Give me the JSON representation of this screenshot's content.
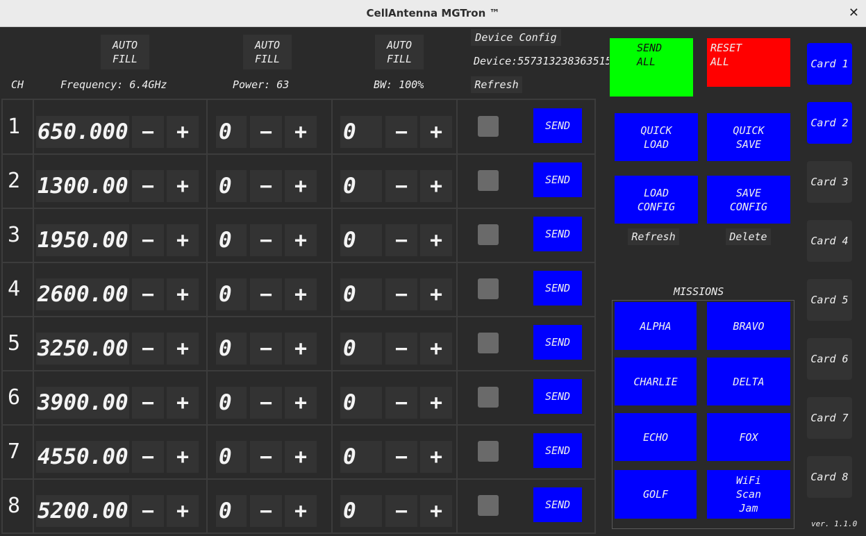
{
  "window": {
    "title": "CellAntenna MGTron ™",
    "close_glyph": "✕"
  },
  "header": {
    "ch_label": "CH",
    "autofill_label": "AUTO\nFILL",
    "frequency_label": "Frequency: 6.4GHz",
    "power_label": "Power: 63",
    "bw_label": "BW: 100%",
    "device_config_label": "Device Config",
    "device_label": "Device:557313238363515",
    "refresh_label": "Refresh"
  },
  "channels": [
    {
      "num": "1",
      "frequency": "650.000",
      "power": "0",
      "bw": "0",
      "send": "SEND"
    },
    {
      "num": "2",
      "frequency": "1300.00",
      "power": "0",
      "bw": "0",
      "send": "SEND"
    },
    {
      "num": "3",
      "frequency": "1950.00",
      "power": "0",
      "bw": "0",
      "send": "SEND"
    },
    {
      "num": "4",
      "frequency": "2600.00",
      "power": "0",
      "bw": "0",
      "send": "SEND"
    },
    {
      "num": "5",
      "frequency": "3250.00",
      "power": "0",
      "bw": "0",
      "send": "SEND"
    },
    {
      "num": "6",
      "frequency": "3900.00",
      "power": "0",
      "bw": "0",
      "send": "SEND"
    },
    {
      "num": "7",
      "frequency": "4550.00",
      "power": "0",
      "bw": "0",
      "send": "SEND"
    },
    {
      "num": "8",
      "frequency": "5200.00",
      "power": "0",
      "bw": "0",
      "send": "SEND"
    }
  ],
  "stepper": {
    "minus": "−",
    "plus": "+"
  },
  "controls": {
    "send_all": "SEND\nALL",
    "reset_all": "RESET\nALL",
    "quick_load": "QUICK\nLOAD",
    "quick_save": "QUICK\nSAVE",
    "load_config": "LOAD\nCONFIG",
    "save_config": "SAVE\nCONFIG",
    "refresh": "Refresh",
    "delete": "Delete",
    "send_all_color": "#00ff00",
    "reset_all_color": "#ff0000",
    "accent_color": "#0000ff"
  },
  "missions": {
    "title": "MISSIONS",
    "items": [
      "ALPHA",
      "BRAVO",
      "CHARLIE",
      "DELTA",
      "ECHO",
      "FOX",
      "GOLF",
      "WiFi\nScan\nJam"
    ]
  },
  "cards": {
    "items": [
      "Card 1",
      "Card 2",
      "Card 3",
      "Card 4",
      "Card 5",
      "Card 6",
      "Card 7",
      "Card 8"
    ],
    "active": [
      true,
      true,
      false,
      false,
      false,
      false,
      false,
      false
    ]
  },
  "version": "ver. 1.1.0"
}
